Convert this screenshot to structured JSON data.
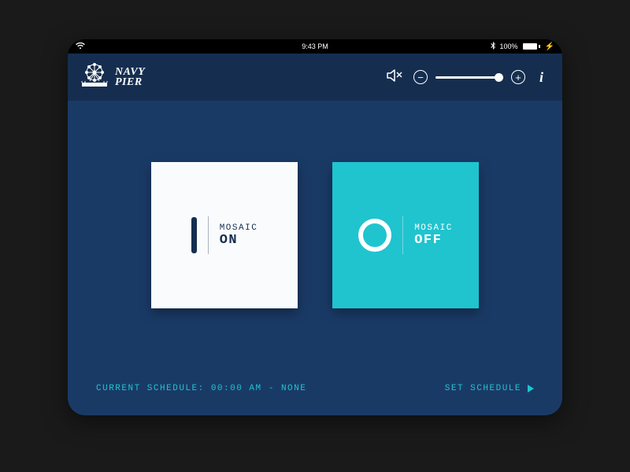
{
  "status": {
    "time": "9:43 PM",
    "battery_pct": "100%",
    "bluetooth": "bluetooth",
    "wifi": "wifi"
  },
  "header": {
    "brand_line1": "NAVY",
    "brand_line2": "PIER"
  },
  "volume": {
    "minus": "−",
    "plus": "+",
    "level_pct": 100
  },
  "info_glyph": "i",
  "tiles": {
    "on": {
      "label": "MOSAIC",
      "state": "ON"
    },
    "off": {
      "label": "MOSAIC",
      "state": "OFF"
    }
  },
  "footer": {
    "schedule_prefix": "CURRENT SCHEDULE: ",
    "schedule_time": "00:00 AM",
    "schedule_sep": " - ",
    "schedule_name": "NONE",
    "set_schedule": "SET SCHEDULE"
  },
  "colors": {
    "header_bg": "#152e50",
    "body_bg": "#1a3a66",
    "accent": "#1fc4cf",
    "tile_on_bg": "#fafbfc"
  }
}
